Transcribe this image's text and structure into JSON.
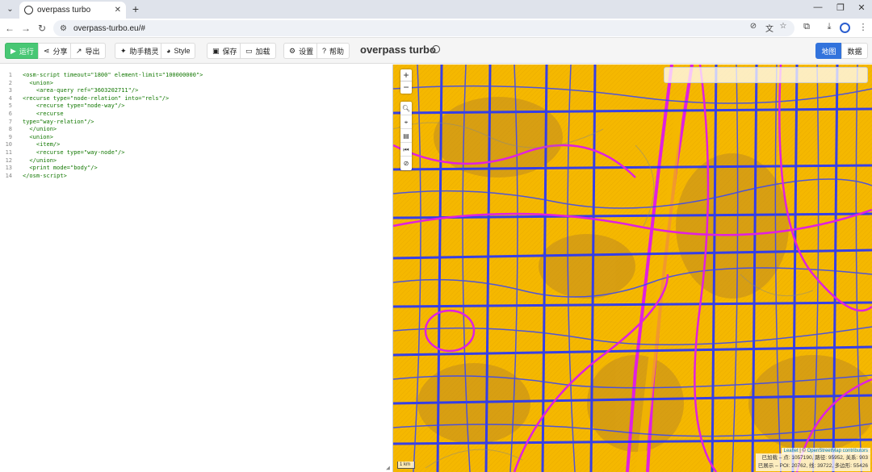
{
  "browser": {
    "tab_title": "overpass turbo",
    "tab_close": "✕",
    "new_tab": "+",
    "url": "overpass-turbo.eu/#",
    "window_controls": [
      "—",
      "❐",
      "✕"
    ]
  },
  "toolbar": {
    "run": "运行",
    "share": "分享",
    "export": "导出",
    "wizard": "助手精灵",
    "style": "Style",
    "save": "保存",
    "load": "加载",
    "settings": "设置",
    "help": "帮助",
    "app_title": "overpass turbo",
    "map_tab": "地图",
    "data_tab": "数据"
  },
  "editor": {
    "line_numbers": [
      "1",
      "2",
      "3",
      "4",
      "5",
      "6",
      "7",
      "8",
      "9",
      "10",
      "11",
      "12",
      "13",
      "14"
    ],
    "lines": [
      "<osm-script timeout=\"1800\" element-limit=\"100000000\">",
      "  <union>",
      "    <area-query ref=\"3603202711\"/>",
      "<recurse type=\"node-relation\" into=\"rels\"/>",
      "    <recurse type=\"node-way\"/>",
      "    <recurse",
      "type=\"way-relation\"/>",
      "  </union>",
      "  <union>",
      "    <item/>",
      "    <recurse type=\"way-node\"/>",
      "  </union>",
      "  <print mode=\"body\"/>",
      "</osm-script>"
    ]
  },
  "map": {
    "zoom_in": "+",
    "zoom_out": "−",
    "scale_label": "1 km",
    "attribution_leaflet": "Leaflet",
    "attribution_sep": " | © ",
    "attribution_osm": "OpenStreetMap contributors",
    "stats_line1": "已加载 – 点: 1057190, 路径: 95952, 关系: 903",
    "stats_line2": "已展示 – POI: 20762, 线: 39722, 多边形: 55426"
  },
  "colors": {
    "map_fill": "#f5b800",
    "way_blue": "#2233ff",
    "relation_magenta": "#e020e0",
    "run_green": "#48c774",
    "tab_active_blue": "#3273dc"
  }
}
